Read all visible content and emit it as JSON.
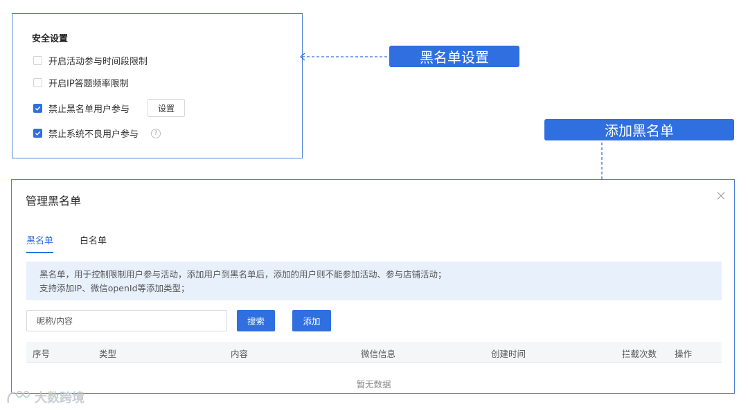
{
  "settings": {
    "title": "安全设置",
    "options": [
      {
        "label": "开启活动参与时间段限制",
        "checked": false
      },
      {
        "label": "开启IP答题频率限制",
        "checked": false
      },
      {
        "label": "禁止黑名单用户参与",
        "checked": true
      },
      {
        "label": "禁止系统不良用户参与",
        "checked": true
      }
    ],
    "set_button": "设置",
    "help_icon": "question-circle-icon"
  },
  "callouts": {
    "blacklist_settings": "黑名单设置",
    "add_blacklist": "添加黑名单"
  },
  "dialog": {
    "title": "管理黑名单",
    "close_icon": "close-icon",
    "tabs": [
      {
        "label": "黑名单",
        "active": true
      },
      {
        "label": "白名单",
        "active": false
      }
    ],
    "info": [
      "黑名单，用于控制限制用户参与活动，添加用户到黑名单后，添加的用户则不能参加活动、参与店铺活动；",
      "支持添加IP、微信openId等添加类型；"
    ],
    "search": {
      "placeholder": "昵称/内容",
      "value": ""
    },
    "search_button": "搜索",
    "add_button": "添加",
    "columns": [
      "序号",
      "类型",
      "内容",
      "微信信息",
      "创建时间",
      "拦截次数",
      "操作"
    ],
    "empty_text": "暂无数据"
  },
  "watermark": "大数跨境",
  "colors": {
    "accent": "#2f6fe0",
    "panel_border": "#4a7fd6",
    "info_bg": "#e8f0fc"
  }
}
